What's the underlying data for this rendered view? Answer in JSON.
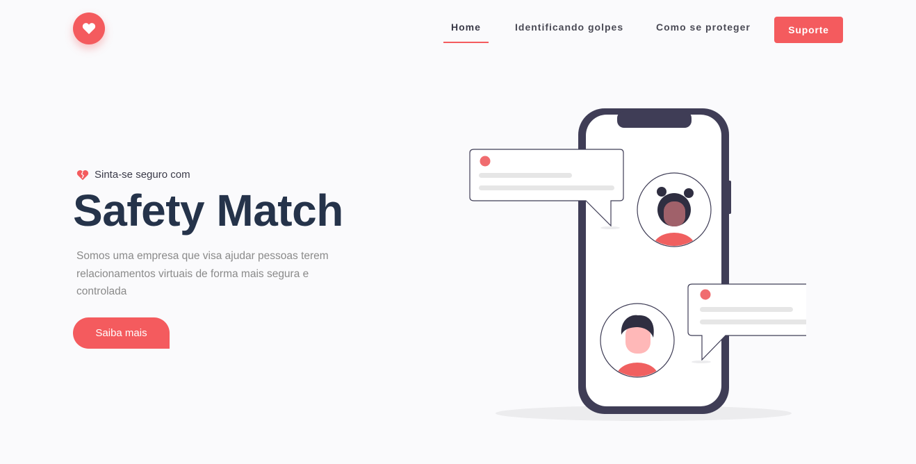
{
  "header": {
    "logo_icon": "heart-icon",
    "nav": [
      {
        "label": "Home",
        "active": true
      },
      {
        "label": "Identificando golpes",
        "active": false
      },
      {
        "label": "Como se proteger",
        "active": false
      }
    ],
    "support_label": "Suporte"
  },
  "hero": {
    "eyebrow_icon": "broken-heart-icon",
    "eyebrow": "Sinta-se seguro com",
    "title": "Safety Match",
    "description": "Somos uma empresa que visa ajudar pessoas terem relacionamentos virtuais de forma mais segura e controlada",
    "cta_label": "Saiba mais"
  },
  "illustration": {
    "icon": "phone-chat-illustration"
  },
  "colors": {
    "accent": "#f45b5e",
    "title": "#25334a",
    "phone": "#3f3d56",
    "background": "#fafafc"
  }
}
